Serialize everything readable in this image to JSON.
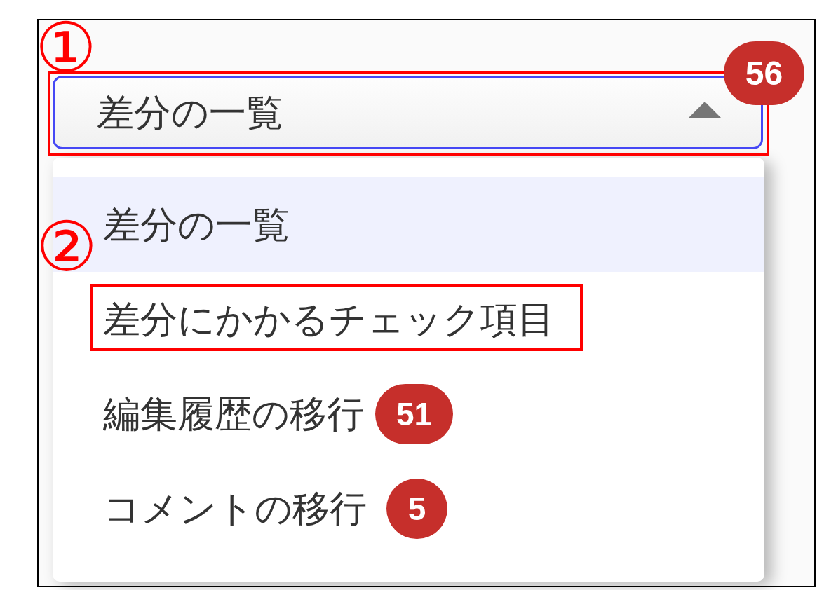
{
  "select": {
    "value": "差分の一覧",
    "focused": true,
    "expanded": true,
    "badge": "56",
    "highlighted": true,
    "callout": "①"
  },
  "menu": {
    "items": [
      {
        "label": "差分の一覧",
        "selected": true,
        "highlighted": false
      },
      {
        "label": "差分にかかるチェック項目",
        "selected": false,
        "highlighted": true,
        "callout": "②"
      },
      {
        "label": "編集履歴の移行",
        "selected": false,
        "highlighted": false,
        "badge": "51"
      },
      {
        "label": "コメントの移行",
        "selected": false,
        "highlighted": false,
        "badge": "5"
      }
    ]
  }
}
